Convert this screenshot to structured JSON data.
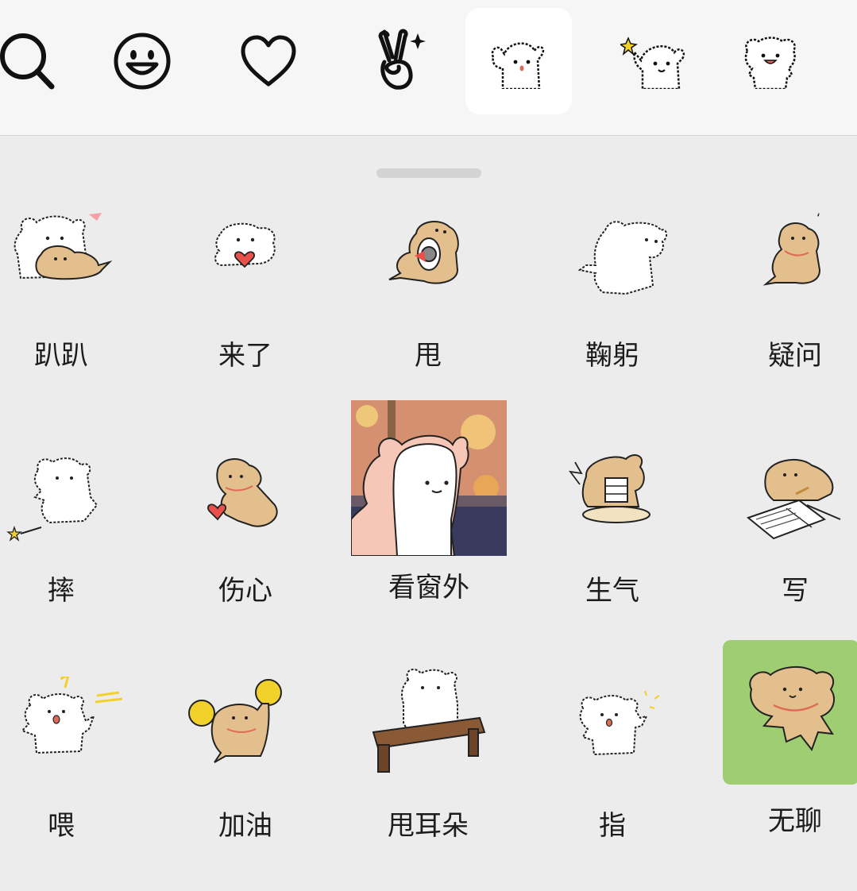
{
  "tabs": [
    {
      "name": "search-tab",
      "icon": "search-icon"
    },
    {
      "name": "emoji-tab",
      "icon": "smiley-icon"
    },
    {
      "name": "favorites-tab",
      "icon": "heart-icon"
    },
    {
      "name": "gesture-tab",
      "icon": "victory-hand-icon"
    },
    {
      "name": "bear-pack-1-tab",
      "icon": "bear-wave-icon",
      "active": true
    },
    {
      "name": "bear-pack-2-tab",
      "icon": "bear-star-icon"
    },
    {
      "name": "bear-pack-3-tab",
      "icon": "bear-smile-icon"
    }
  ],
  "stickers": [
    {
      "label": "趴趴",
      "icon": "bear-and-dog-lying-icon"
    },
    {
      "label": "来了",
      "icon": "dog-with-heart-icon"
    },
    {
      "label": "甩",
      "icon": "dog-spinning-icon"
    },
    {
      "label": "鞠躬",
      "icon": "bear-bowing-icon"
    },
    {
      "label": "疑问",
      "icon": "dog-question-icon"
    },
    {
      "label": "摔",
      "icon": "bear-falling-icon"
    },
    {
      "label": "伤心",
      "icon": "dog-sad-heart-icon"
    },
    {
      "label": "看窗外",
      "icon": "bear-window-icon"
    },
    {
      "label": "生气",
      "icon": "dog-angry-icon"
    },
    {
      "label": "写",
      "icon": "dog-writing-icon"
    },
    {
      "label": "喂",
      "icon": "bear-shouting-icon"
    },
    {
      "label": "加油",
      "icon": "dog-cheering-icon"
    },
    {
      "label": "甩耳朵",
      "icon": "bear-on-bench-icon"
    },
    {
      "label": "指",
      "icon": "bear-pointing-icon"
    },
    {
      "label": "无聊",
      "icon": "dog-bored-icon"
    }
  ],
  "colors": {
    "dog": "#e2bf8c",
    "bear": "#ffffff",
    "outline": "#222222",
    "boredBg": "#9fce72",
    "collar": "#e06a5a"
  }
}
